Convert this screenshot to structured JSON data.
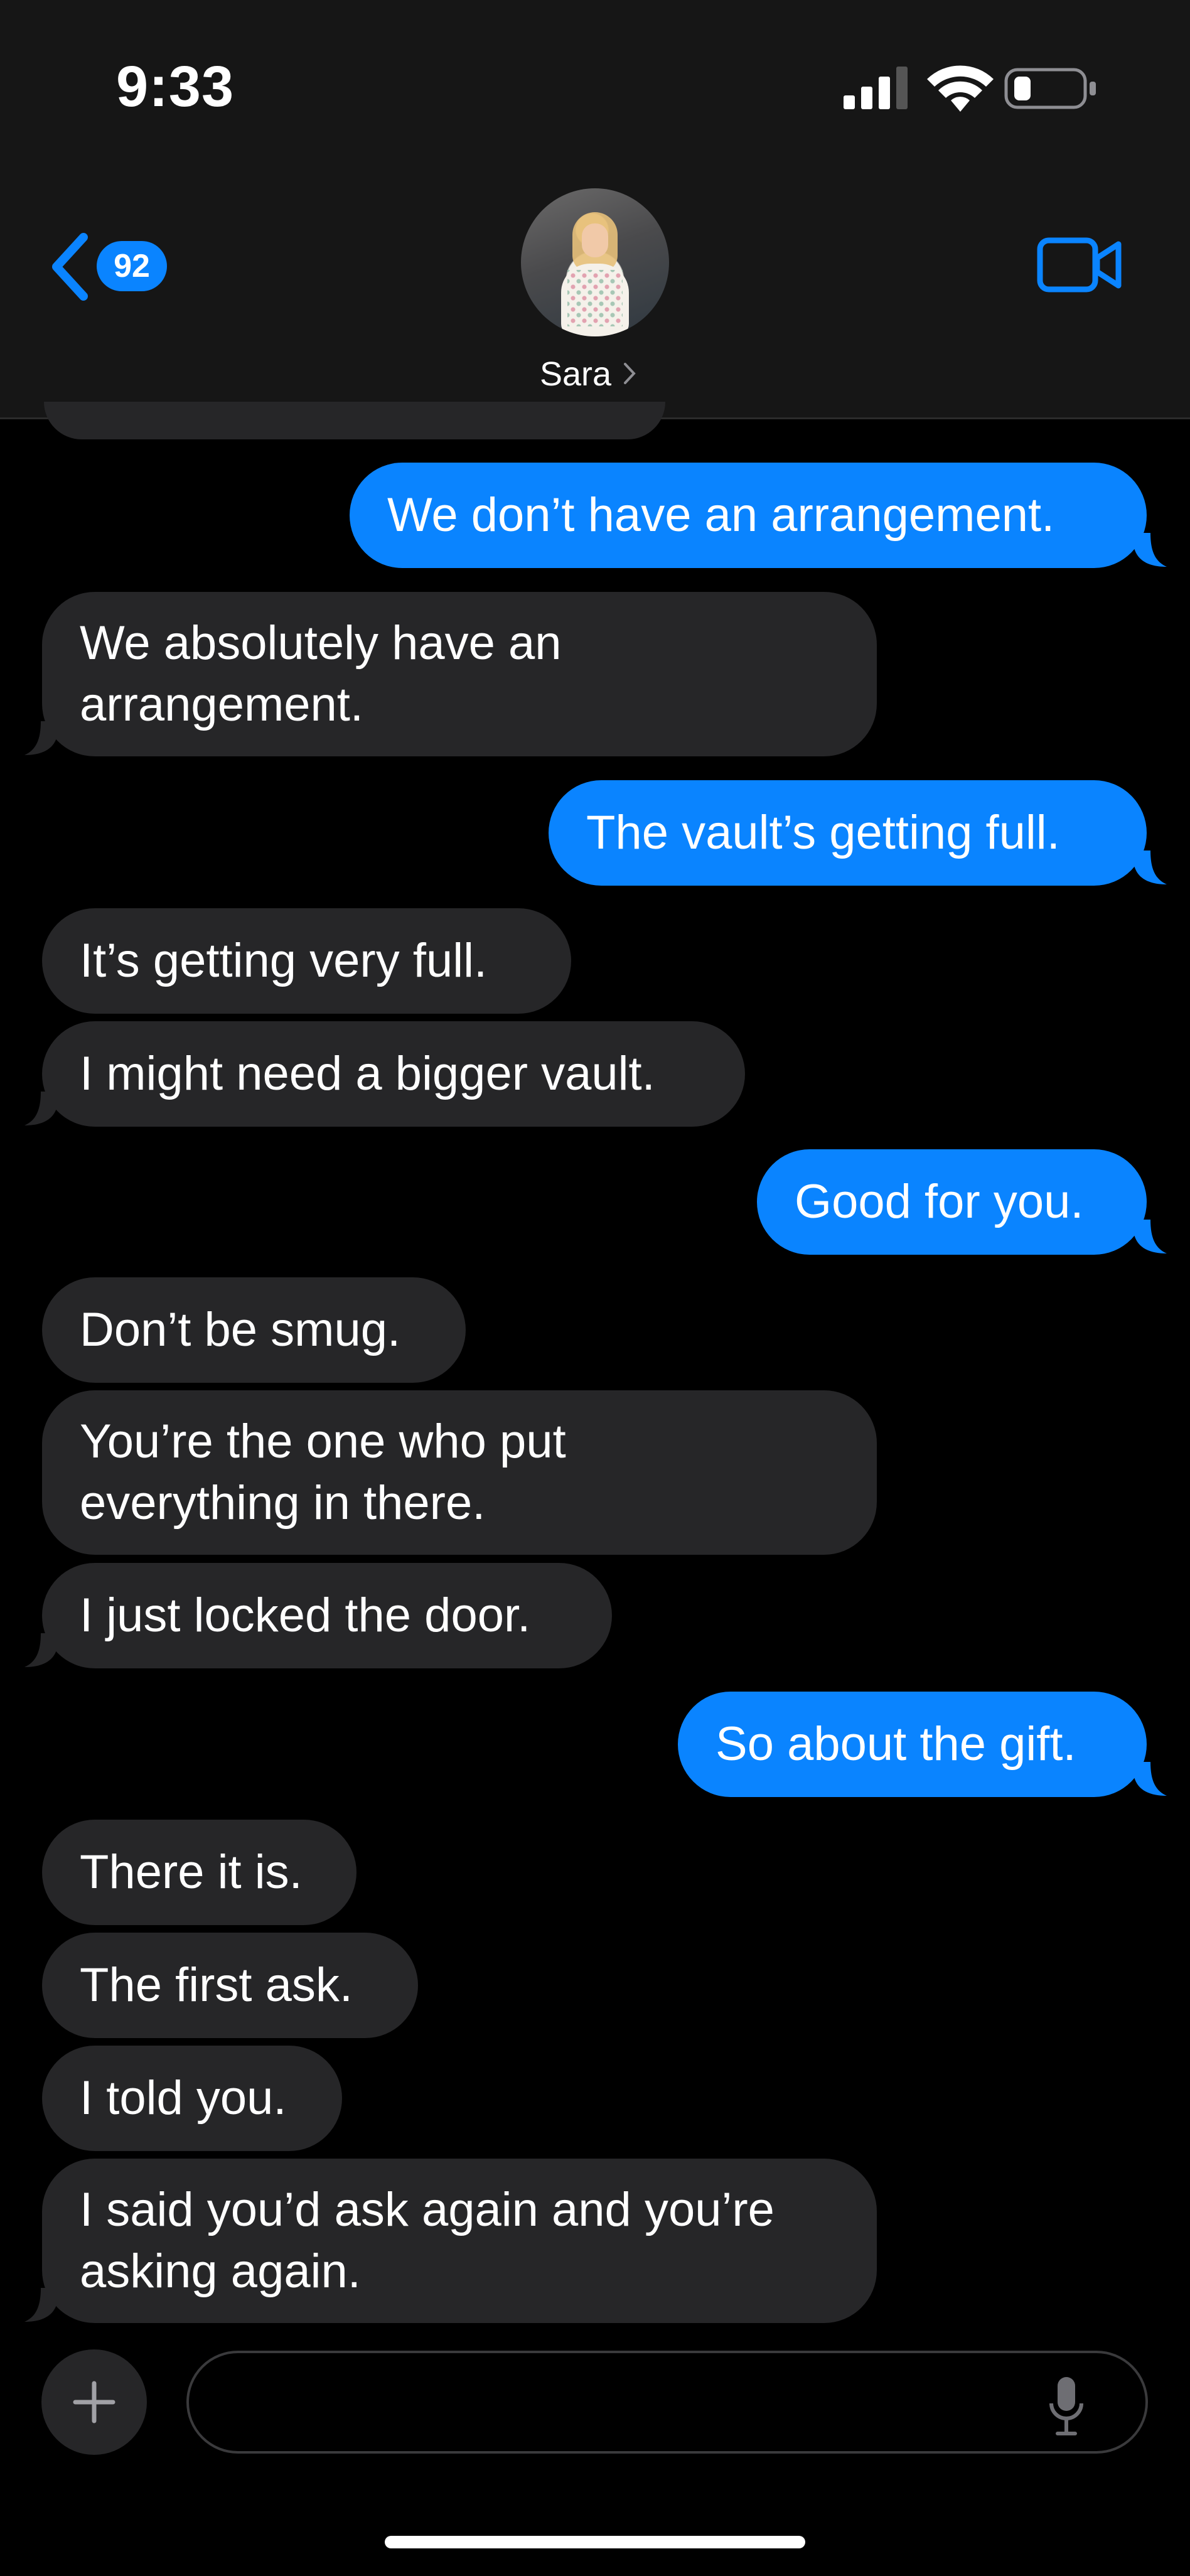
{
  "status_bar": {
    "time": "9:33"
  },
  "header": {
    "back_badge_count": "92",
    "contact_name": "Sara"
  },
  "messages": [
    {
      "from": "me",
      "lines": [
        "We don’t have an arrangement."
      ]
    },
    {
      "from": "them",
      "lines": [
        "We absolutely have an",
        "arrangement."
      ]
    },
    {
      "from": "me",
      "lines": [
        "The vault’s getting full."
      ]
    },
    {
      "from": "them",
      "lines": [
        "It’s getting very full."
      ]
    },
    {
      "from": "them",
      "lines": [
        "I might need a bigger vault."
      ]
    },
    {
      "from": "me",
      "lines": [
        "Good for you."
      ]
    },
    {
      "from": "them",
      "lines": [
        "Don’t be smug."
      ]
    },
    {
      "from": "them",
      "lines": [
        "You’re the one who put",
        "everything in there."
      ]
    },
    {
      "from": "them",
      "lines": [
        "I just locked the door."
      ]
    },
    {
      "from": "me",
      "lines": [
        "So about the gift."
      ]
    },
    {
      "from": "them",
      "lines": [
        "There it is."
      ]
    },
    {
      "from": "them",
      "lines": [
        "The first ask."
      ]
    },
    {
      "from": "them",
      "lines": [
        "I told you."
      ]
    },
    {
      "from": "them",
      "lines": [
        "I said you’d ask again and you’re",
        "asking again."
      ]
    }
  ],
  "compose": {
    "placeholder": ""
  },
  "colors": {
    "outgoing": "#0a84ff",
    "incoming": "#262628",
    "background": "#000000",
    "header": "#161616"
  },
  "icons": [
    "back-chevron-icon",
    "video-camera-icon",
    "plus-icon",
    "microphone-icon",
    "cellular-signal-icon",
    "wifi-icon",
    "battery-icon"
  ]
}
